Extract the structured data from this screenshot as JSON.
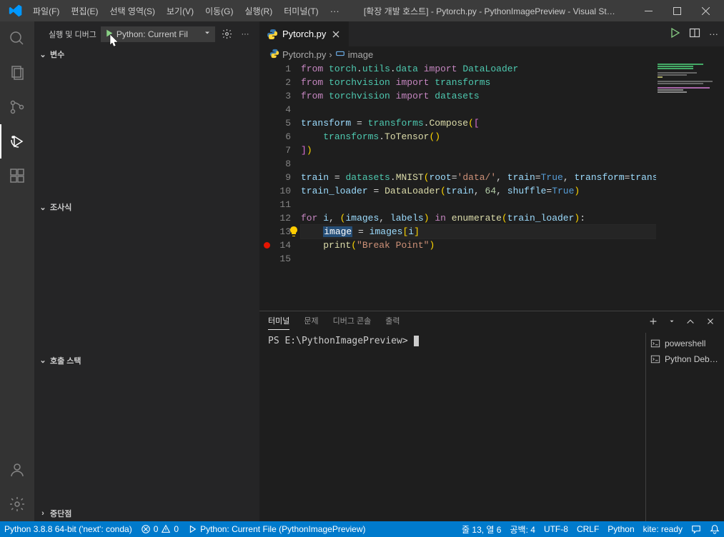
{
  "menu": [
    "파일(F)",
    "편집(E)",
    "선택 영역(S)",
    "보기(V)",
    "이동(G)",
    "실행(R)",
    "터미널(T)"
  ],
  "title": "[확장 개발 호스트] - Pytorch.py - PythonImagePreview - Visual St…",
  "sidePanel": {
    "title": "실행 및 디버그",
    "config": "Python: Current Fil",
    "sections": {
      "variables": "변수",
      "watch": "조사식",
      "callstack": "호출 스택",
      "breakpoints": "중단점"
    }
  },
  "tab": {
    "name": "Pytorch.py"
  },
  "breadcrumb": {
    "file": "Pytorch.py",
    "symbol": "image"
  },
  "code": {
    "lines": [
      "1",
      "2",
      "3",
      "4",
      "5",
      "6",
      "7",
      "8",
      "9",
      "10",
      "11",
      "12",
      "13",
      "14",
      "15"
    ]
  },
  "terminal": {
    "tabs": [
      "터미널",
      "문제",
      "디버그 콘솔",
      "출력"
    ],
    "prompt": "PS E:\\PythonImagePreview> ",
    "sessions": [
      "powershell",
      "Python Deb…"
    ]
  },
  "status": {
    "python": "Python 3.8.8 64-bit ('next': conda)",
    "errors": "0",
    "warnings": "0",
    "debugConfig": "Python: Current File (PythonImagePreview)",
    "lncol": "줄 13, 열 6",
    "spaces": "공백: 4",
    "encoding": "UTF-8",
    "eol": "CRLF",
    "lang": "Python",
    "kite": "kite: ready"
  }
}
